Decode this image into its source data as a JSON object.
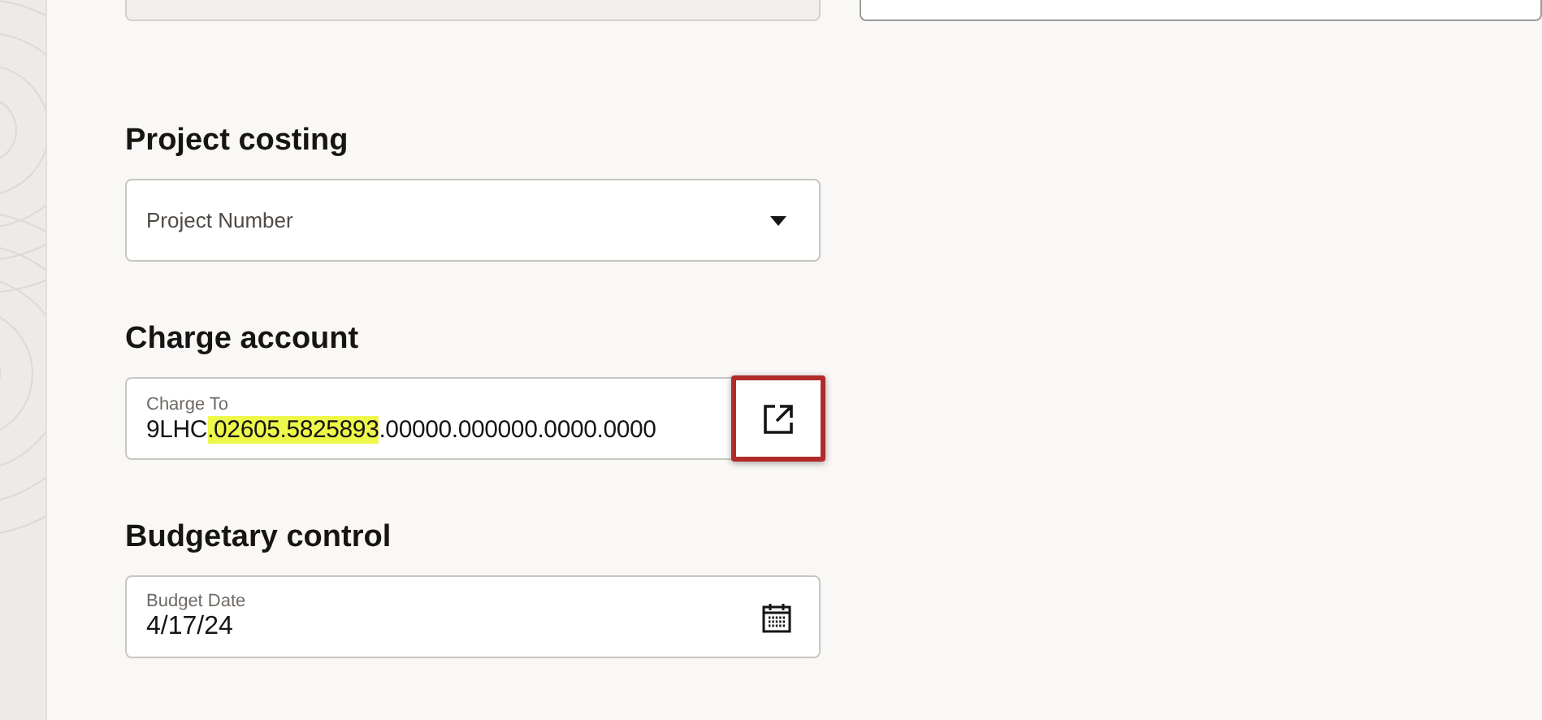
{
  "top_fields": [
    {
      "kind": "readonly"
    },
    {
      "kind": "editable"
    }
  ],
  "sections": [
    {
      "heading": "Project costing",
      "field": {
        "kind": "select",
        "placeholder": "Project Number"
      }
    },
    {
      "heading": "Charge account",
      "field": {
        "kind": "account",
        "label": "Charge To",
        "value_parts": [
          {
            "text": "9LHC",
            "highlighted": false
          },
          {
            "text": ".02605.5825893",
            "highlighted": true
          },
          {
            "text": ".00000.000000.0000.0000",
            "highlighted": false
          }
        ],
        "button_marked": true
      }
    },
    {
      "heading": "Budgetary control",
      "field": {
        "kind": "date",
        "label": "Budget Date",
        "value": "4/17/24"
      }
    }
  ]
}
